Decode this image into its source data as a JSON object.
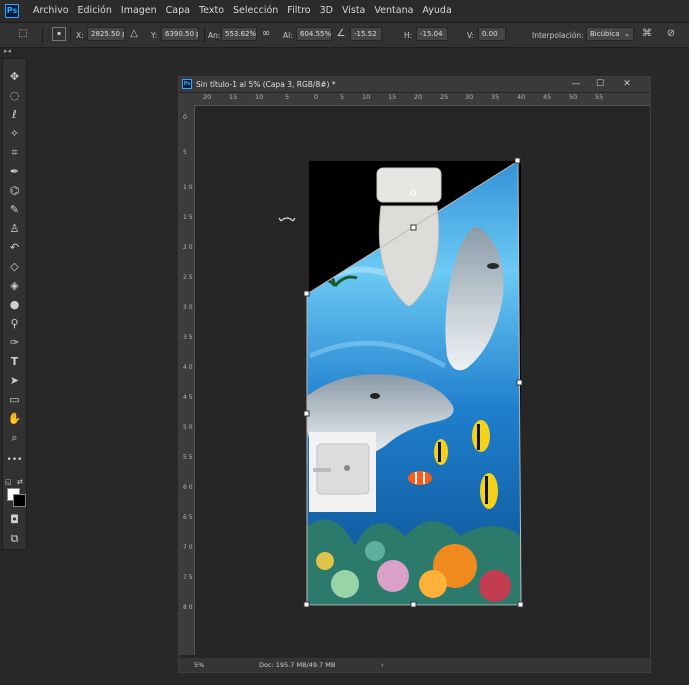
{
  "menubar": {
    "logo": "Ps",
    "items": [
      "Archivo",
      "Edición",
      "Imagen",
      "Capa",
      "Texto",
      "Selección",
      "Filtro",
      "3D",
      "Vista",
      "Ventana",
      "Ayuda"
    ]
  },
  "options": {
    "x_label": "X:",
    "x_value": "2825.50 px",
    "y_label": "Y:",
    "y_value": "6390.50 px",
    "width_label": "An:",
    "width_value": "553.62%",
    "height_label": "Al:",
    "height_value": "604.55%",
    "angle_value": "-15.52",
    "h_label": "H:",
    "h_value": "-15.04",
    "v_label": "V:",
    "v_value": "0.00",
    "interp_label": "Interpolación:",
    "interp_value": "Bicúbica"
  },
  "document": {
    "logo": "Ps",
    "title": "Sin título-1 al 5% (Capa 3, RGB/8#) *",
    "zoom": "5%",
    "doc_info": "Doc: 195.7 MB/49.7 MB",
    "ruler_h": [
      "20",
      "15",
      "10",
      "5",
      "0",
      "5",
      "10",
      "15",
      "20",
      "25",
      "30",
      "35",
      "40",
      "45",
      "50",
      "55"
    ],
    "ruler_v": [
      "0",
      "5",
      "1 0",
      "1 5",
      "2 0",
      "2 5",
      "3 0",
      "3 5",
      "4 0",
      "4 5",
      "5 0",
      "5 5",
      "6 0",
      "6 5",
      "7 0",
      "7 5",
      "8 0"
    ]
  },
  "colors": {
    "app_bg": "#282828",
    "panel": "#323232",
    "water_light": "#7fd4ff",
    "water_deep": "#0a5aa8"
  },
  "tools": [
    "move-icon",
    "marquee-icon",
    "lasso-icon",
    "magic-wand-icon",
    "crop-icon",
    "eyedropper-icon",
    "healing-icon",
    "brush-icon",
    "stamp-icon",
    "history-brush-icon",
    "eraser-icon",
    "bucket-icon",
    "dodge-icon",
    "pen-icon",
    "type-icon",
    "path-select-icon",
    "rectangle-icon",
    "hand-icon",
    "zoom-icon",
    "more-icon"
  ]
}
